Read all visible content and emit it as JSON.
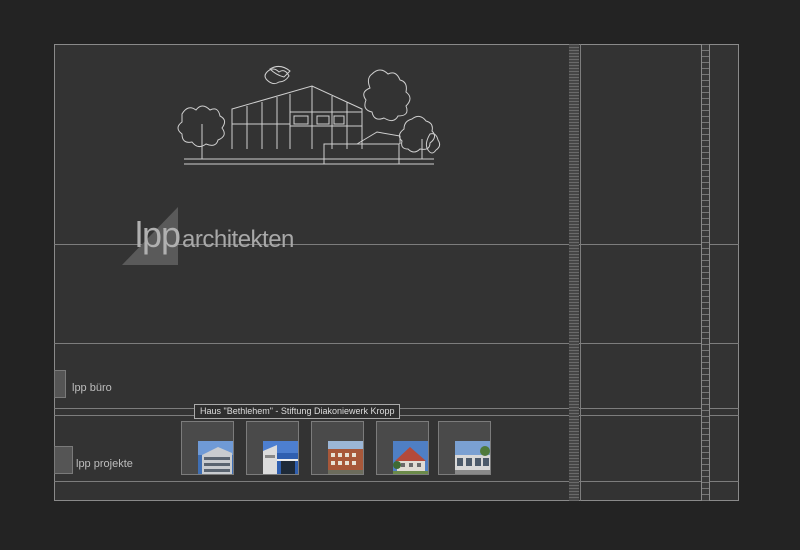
{
  "logo": {
    "lpp": "lpp",
    "architekten": "architekten"
  },
  "nav": {
    "buero_label": "lpp büro",
    "projekte_label": "lpp projekte"
  },
  "tooltip": {
    "text": "Haus \"Bethlehem\" - Stiftung Diakoniewerk Kropp"
  },
  "projects": [
    {
      "name": "project-1",
      "photo_icon": "building-photo"
    },
    {
      "name": "project-2",
      "photo_icon": "building-photo"
    },
    {
      "name": "project-3",
      "photo_icon": "building-photo"
    },
    {
      "name": "project-4",
      "photo_icon": "building-photo"
    },
    {
      "name": "project-5",
      "photo_icon": "building-photo"
    }
  ],
  "colors": {
    "background": "#232323",
    "panel": "#333333",
    "lines": "#7d7d7d",
    "text": "#bdbdbd"
  }
}
